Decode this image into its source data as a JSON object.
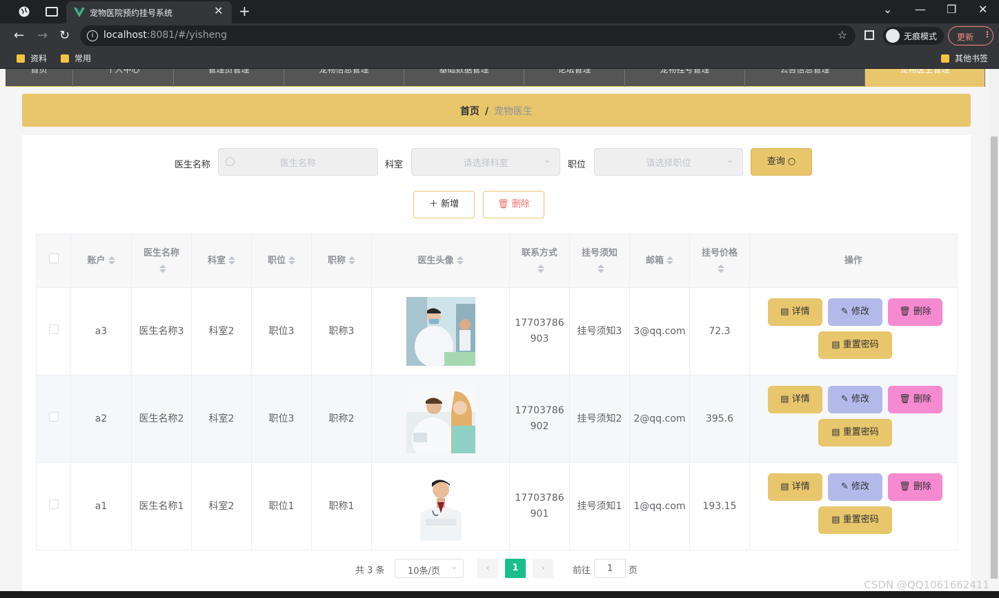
{
  "browser": {
    "tab_title": "宠物医院预约挂号系统",
    "url_host": "localhost",
    "url_rest": ":8081/#/yisheng",
    "incognito_label": "无痕模式",
    "update_label": "更新",
    "bookmarks": [
      "资料",
      "常用"
    ],
    "other_bookmarks": "其他书签"
  },
  "topnav": {
    "items": [
      "首页",
      "个人中心",
      "管理员管理",
      "宠物信息管理",
      "基础数据管理",
      "论坛管理",
      "宠物挂号管理",
      "公告信息管理",
      "宠物医生管理"
    ]
  },
  "breadcrumb": {
    "home": "首页",
    "sep": "/",
    "current": "宠物医生"
  },
  "search": {
    "name_label": "医生名称",
    "name_placeholder": "医生名称",
    "dept_label": "科室",
    "dept_placeholder": "请选择科室",
    "pos_label": "职位",
    "pos_placeholder": "请选择职位",
    "query_label": "查询"
  },
  "actions": {
    "add": "新增",
    "delete": "删除"
  },
  "table": {
    "headers": [
      "账户",
      "医生名称",
      "科室",
      "职位",
      "职称",
      "医生头像",
      "联系方式",
      "挂号须知",
      "邮箱",
      "挂号价格",
      "操作"
    ],
    "rows": [
      {
        "account": "a3",
        "name": "医生名称3",
        "dept": "科室2",
        "pos": "职位3",
        "title": "职称3",
        "phone": "17703786903",
        "notice": "挂号须知3",
        "email": "3@qq.com",
        "price": "72.3"
      },
      {
        "account": "a2",
        "name": "医生名称2",
        "dept": "科室2",
        "pos": "职位3",
        "title": "职称2",
        "phone": "17703786902",
        "notice": "挂号须知2",
        "email": "2@qq.com",
        "price": "395.6"
      },
      {
        "account": "a1",
        "name": "医生名称1",
        "dept": "科室2",
        "pos": "职位1",
        "title": "职称1",
        "phone": "17703786901",
        "notice": "挂号须知1",
        "email": "1@qq.com",
        "price": "193.15"
      }
    ],
    "row_actions": {
      "detail": "详情",
      "edit": "修改",
      "delete": "删除",
      "reset": "重置密码"
    }
  },
  "pagination": {
    "total": "共 3 条",
    "page_size": "10条/页",
    "current": "1",
    "goto_prefix": "前往",
    "goto_value": "1",
    "goto_suffix": "页"
  },
  "watermark": "CSDN @QQ1061662411",
  "colors": {
    "accent": "#e8c66c",
    "pager_active": "#19be8b",
    "edit_btn": "#b3b9e8",
    "delete_btn": "#f58ad0"
  }
}
